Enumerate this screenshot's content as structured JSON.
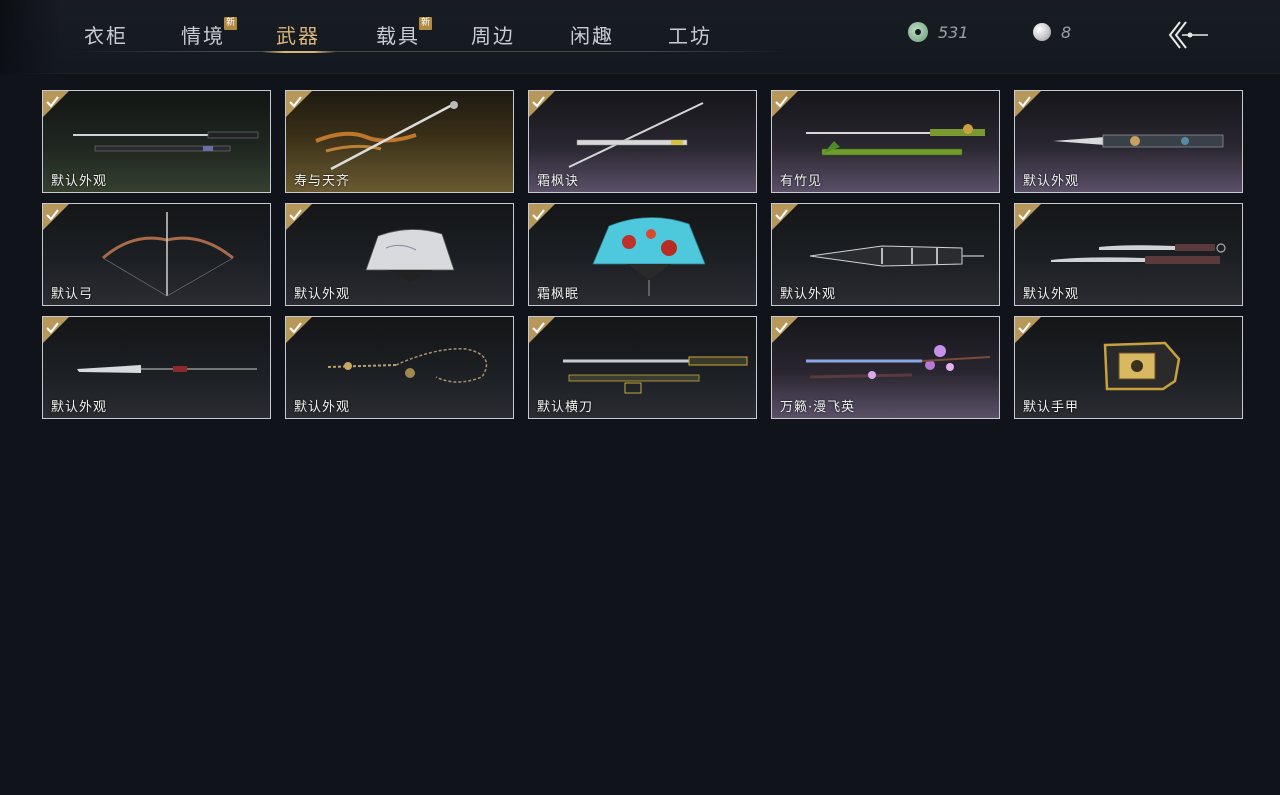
{
  "tabs": [
    {
      "label": "衣柜",
      "active": false,
      "new_badge": ""
    },
    {
      "label": "情境",
      "active": false,
      "new_badge": "新"
    },
    {
      "label": "武器",
      "active": true,
      "new_badge": ""
    },
    {
      "label": "载具",
      "active": false,
      "new_badge": "新"
    },
    {
      "label": "周边",
      "active": false,
      "new_badge": ""
    },
    {
      "label": "闲趣",
      "active": false,
      "new_badge": ""
    },
    {
      "label": "工坊",
      "active": false,
      "new_badge": ""
    }
  ],
  "currency": {
    "jade": {
      "icon": "jade-coin-icon",
      "amount": "531"
    },
    "pearl": {
      "icon": "pearl-icon",
      "amount": "8"
    }
  },
  "back_icon": "back-arrow-icon",
  "colors": {
    "accent": "#d9b57a",
    "badge": "#b08a45",
    "background": "#10141a",
    "card_border": "#c7cbd1"
  },
  "items": [
    {
      "label": "默认外观",
      "art": "sword",
      "owned": true
    },
    {
      "label": "寿与天齐",
      "art": "gold-sword",
      "owned": true
    },
    {
      "label": "霜枫诀",
      "art": "thin-sword",
      "owned": true
    },
    {
      "label": "有竹见",
      "art": "bamboo-sword",
      "owned": true
    },
    {
      "label": "默认外观",
      "art": "mech-blade",
      "owned": true
    },
    {
      "label": "默认弓",
      "art": "bow",
      "owned": true
    },
    {
      "label": "默认外观",
      "art": "grey-fan",
      "owned": true
    },
    {
      "label": "霜枫眠",
      "art": "blue-fan",
      "owned": true
    },
    {
      "label": "默认外观",
      "art": "umbrella",
      "owned": true
    },
    {
      "label": "默认外观",
      "art": "dual-blades",
      "owned": true
    },
    {
      "label": "默认外观",
      "art": "glaive",
      "owned": true
    },
    {
      "label": "默认外观",
      "art": "chain-whip",
      "owned": true
    },
    {
      "label": "默认横刀",
      "art": "hengdao",
      "owned": true
    },
    {
      "label": "万籁·漫飞英",
      "art": "blossom-sword",
      "owned": true
    },
    {
      "label": "默认手甲",
      "art": "gauntlet",
      "owned": true
    }
  ]
}
